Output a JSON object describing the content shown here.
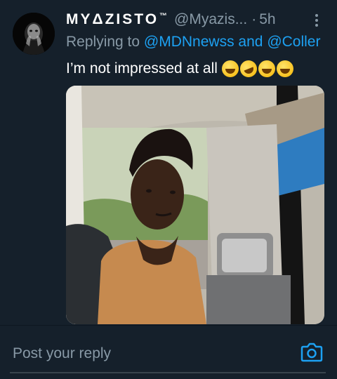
{
  "tweet": {
    "display_name": "MYΔZISTO",
    "name_suffix": "™",
    "handle": "@Myazis...",
    "separator": "·",
    "time": "5h",
    "replying_prefix": "Replying to",
    "mention_1": "@MDNnewss",
    "mention_joiner": "and",
    "mention_2": "@Coller",
    "text": "I’m not impressed at all",
    "emojis": [
      "face-with-tears-of-joy",
      "rolling-on-the-floor-laughing",
      "face-with-tears-of-joy",
      "face-with-tears-of-joy"
    ]
  },
  "composer": {
    "placeholder": "Post your reply",
    "camera_icon": "camera-icon"
  },
  "colors": {
    "background": "#15202b",
    "text": "#ffffff",
    "muted": "#8899a6",
    "accent": "#1da1f2"
  }
}
